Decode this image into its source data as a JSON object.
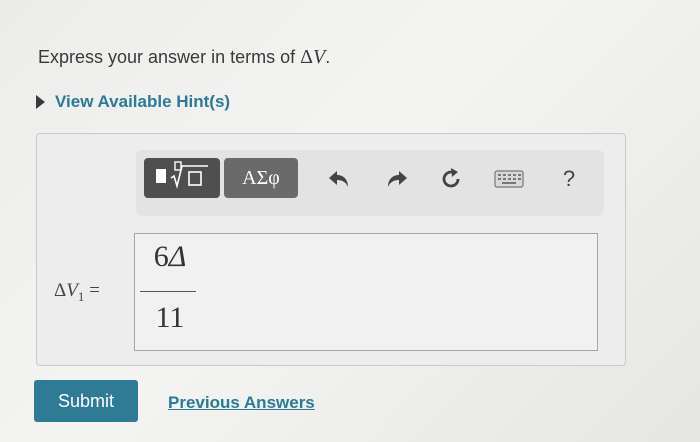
{
  "prompt": {
    "text": "Express your answer in terms of ",
    "math_delta": "Δ",
    "math_var": "V",
    "period": "."
  },
  "hint": {
    "label": "View Available Hint(s)"
  },
  "toolbar": {
    "templates_icon": "fraction-sqrt-templates-icon",
    "symbols_label": "ΑΣφ",
    "undo_icon": "undo-icon",
    "redo_icon": "redo-icon",
    "reset_icon": "reset-icon",
    "keyboard_icon": "keyboard-icon",
    "help_label": "?"
  },
  "answer": {
    "label_delta": "Δ",
    "label_var": "V",
    "label_sub": "1",
    "label_eq": " =",
    "numerator_num": "6",
    "numerator_sym": "Δ",
    "denominator": "11"
  },
  "actions": {
    "submit_label": "Submit",
    "previous_label": "Previous Answers"
  },
  "colors": {
    "accent": "#2f7b95",
    "link": "#2c7a96",
    "toolbar_button": "#5d5d5d"
  }
}
